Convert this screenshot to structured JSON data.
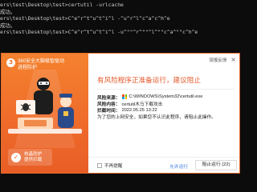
{
  "console": {
    "lines": [
      "ers\\test\\Desktop\\test>certutil -urlcache",
      "成功。",
      "",
      "ers\\test\\Desktop\\test>C^e^r^t^u^t^i^l -^u^r^l^c^a^c^h^e",
      "成功。",
      "",
      "ers\\test\\Desktop\\test>C^e^r^t^u^t^i^l -u^\"\"^r^\"\"^l^\"\"c^a^\"\"c^h^e"
    ]
  },
  "dialog": {
    "brand": {
      "logo": "3",
      "line1": "360安全大脑极智驱动",
      "line2": "进程防护"
    },
    "guard": {
      "line1": "核晶防护",
      "line2": "提供拦截"
    },
    "report_link": "误报反馈",
    "close": "×",
    "headline": "有风险程序正准备运行，建议阻止",
    "rows": {
      "source_label": "风险来源：",
      "source_value": "C:\\WINDOWS\\System32\\certutil.exe",
      "content_label": "风险内容：",
      "content_value": "certutil木马下载攻击",
      "time_label": "拦截时间：",
      "time_value": "2022.05.25 13:22"
    },
    "description": "为了您的上网安全，如果您不认识此程序，请阻止此操作。",
    "checkbox_label": "不再提醒",
    "allow_label": "允许运行",
    "block_label": "阻止运行 (22)",
    "colors": {
      "accent": "#ef6a2a",
      "headline": "#e2582a",
      "link": "#3b7ad9"
    }
  }
}
